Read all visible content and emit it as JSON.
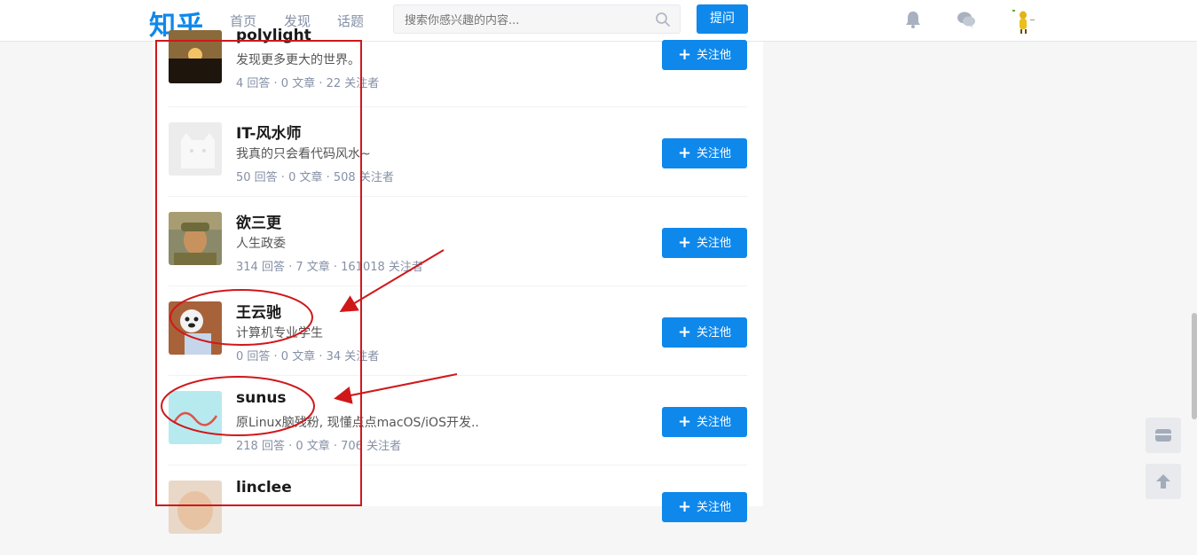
{
  "header": {
    "logo": "知乎",
    "nav": [
      "首页",
      "发现",
      "话题"
    ],
    "search_placeholder": "搜索你感兴趣的内容...",
    "ask_label": "提问",
    "icons": [
      "search-icon",
      "bell-icon",
      "chat-icon"
    ]
  },
  "users": [
    {
      "name": "polylight",
      "bio": "发现更多更大的世界。",
      "stats": "4 回答 · 0 文章 · 22 关注者",
      "follow": "关注他"
    },
    {
      "name": "IT-风水师",
      "bio": "我真的只会看代码风水~",
      "stats": "50 回答 · 0 文章 · 508 关注者",
      "follow": "关注他"
    },
    {
      "name": "欲三更",
      "bio": "人生政委",
      "stats": "314 回答 · 7 文章 · 161018 关注者",
      "follow": "关注他"
    },
    {
      "name": "王云驰",
      "bio": "计算机专业学生",
      "stats": "0 回答 · 0 文章 · 34 关注者",
      "follow": "关注他"
    },
    {
      "name": "sunus",
      "bio": "原Linux脑残粉, 现懂点点macOS/iOS开发..",
      "stats": "218 回答 · 0 文章 · 706 关注者",
      "follow": "关注他"
    },
    {
      "name": "linclee",
      "bio": "",
      "stats": "",
      "follow": "关注他"
    }
  ],
  "colors": {
    "brand": "#0f88eb",
    "annotation": "#d0181b"
  }
}
